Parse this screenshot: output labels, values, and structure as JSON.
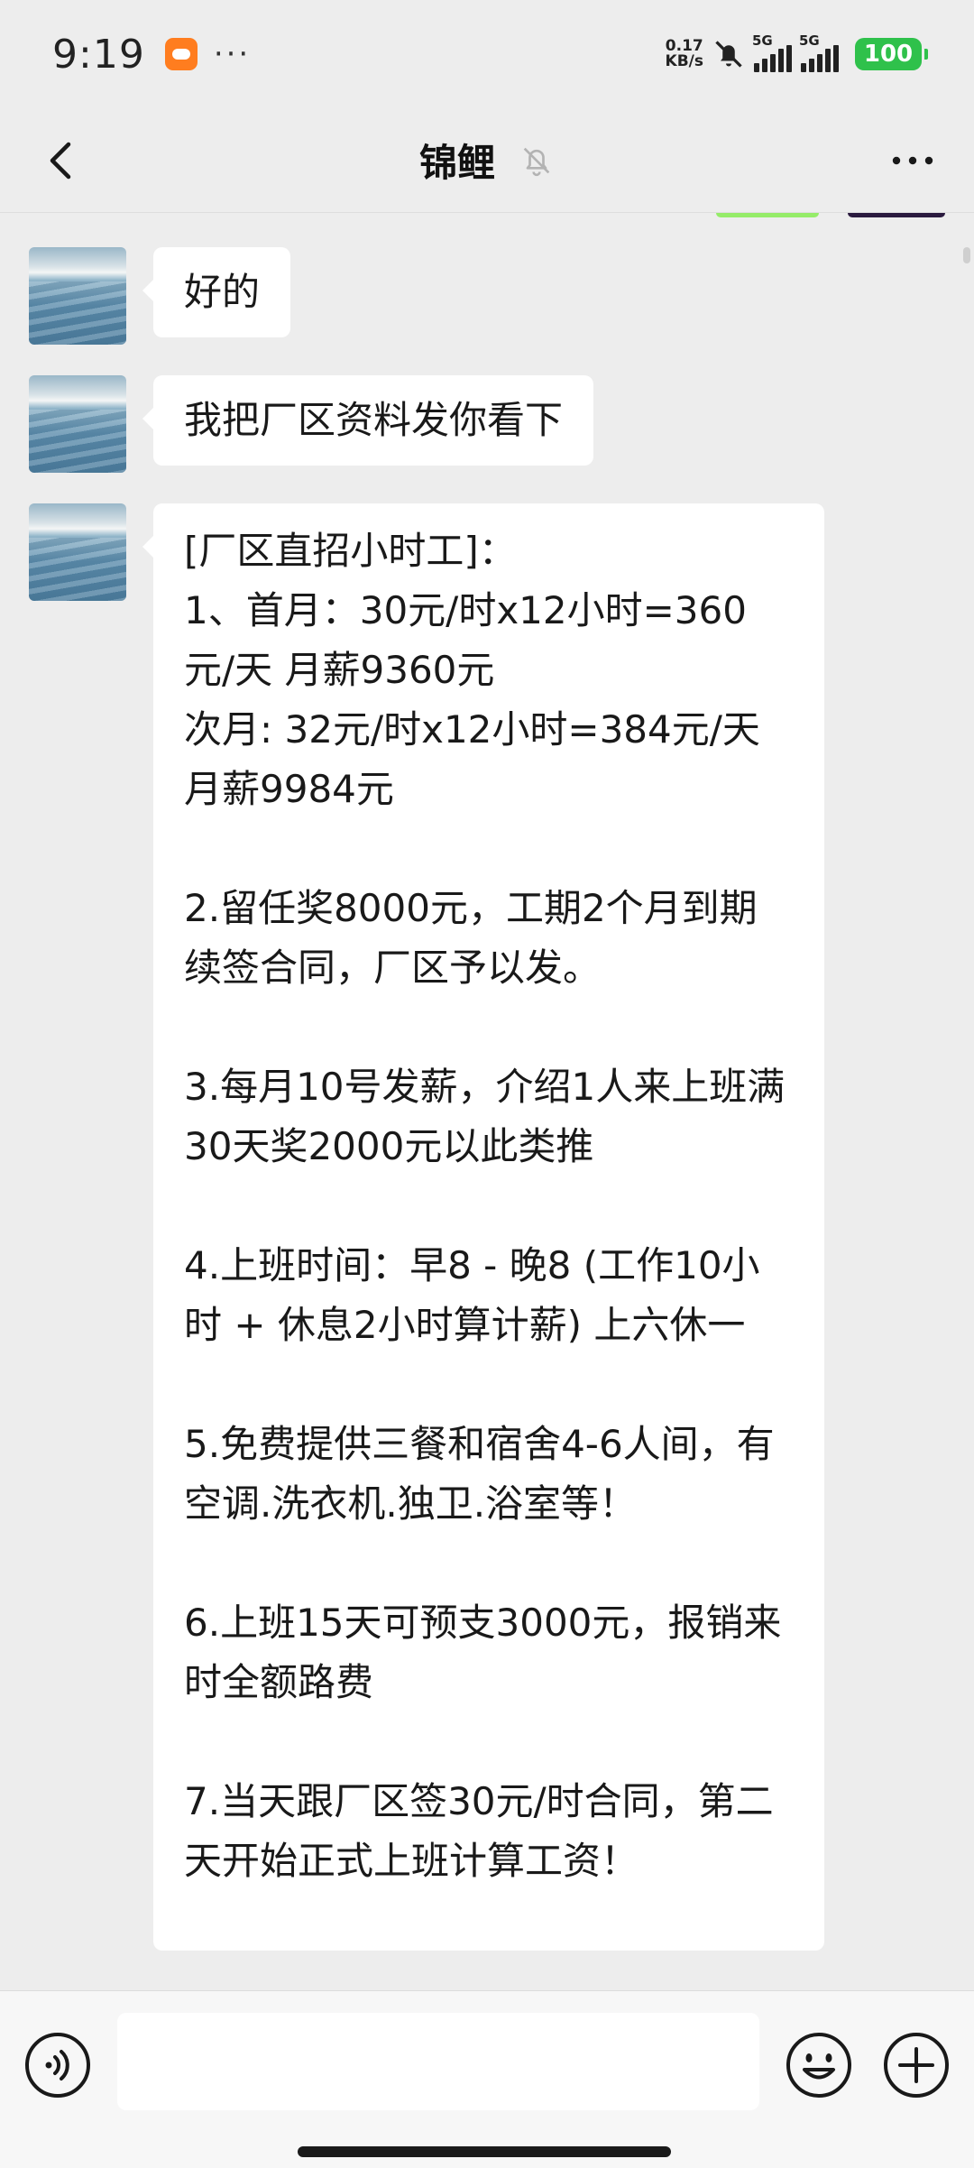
{
  "status_bar": {
    "time": "9:19",
    "more": "···",
    "net_speed_value": "0.17",
    "net_speed_unit": "KB/s",
    "signal1_label": "5G",
    "signal2_label": "5G",
    "battery": "100",
    "battery_color": "#2fc14b"
  },
  "header": {
    "title": "锦鲤",
    "back_icon": "chevron-left-icon",
    "mute_icon": "bell-off-icon",
    "more_icon": "more-dots-icon"
  },
  "messages": [
    {
      "text": "好的"
    },
    {
      "text": "我把厂区资料发你看下"
    }
  ],
  "long_message": {
    "lines": [
      "[厂区直招小时工]：",
      "1、首月：30元/时x12小时=360元/天 月薪9360元",
      "次月: 32元/时x12小时=384元/天 月薪9984元",
      "",
      "2.留任奖8000元，工期2个月到期续签合同，厂区予以发。",
      "",
      "3.每月10号发薪，介绍1人来上班满30天奖2000元以此类推",
      "",
      "4.上班时间：早8 - 晚8 (工作10小时 + 休息2小时算计薪) 上六休一",
      "",
      "5.免费提供三餐和宿舍4-6人间，有空调.洗衣机.独卫.浴室等！",
      "",
      "6.上班15天可预支3000元，报销来时全额路费",
      "",
      "7.当天跟厂区签30元/时合同，第二天开始正式上班计算工资！"
    ]
  },
  "input_bar": {
    "voice_icon": "voice-icon",
    "emoji_icon": "emoji-icon",
    "plus_icon": "plus-icon",
    "input_value": ""
  },
  "colors": {
    "background": "#ededed",
    "bubble": "#ffffff",
    "sent_bubble": "#95ec69"
  }
}
